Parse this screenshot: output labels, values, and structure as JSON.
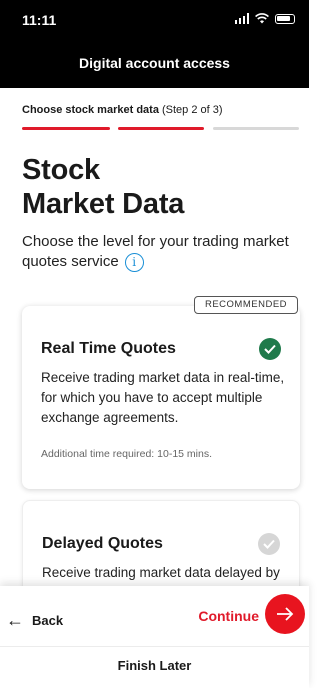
{
  "status_bar": {
    "time": "11:11"
  },
  "header": {
    "title": "Digital account access"
  },
  "step": {
    "label": "Choose stock market data",
    "counter": "(Step 2 of 3)"
  },
  "page": {
    "heading_line1": "Stock",
    "heading_line2": "Market Data",
    "subtitle": "Choose the level for your trading market quotes service"
  },
  "options": [
    {
      "badge": "RECOMMENDED",
      "title": "Real Time Quotes",
      "description": "Receive trading market data in real-time, for which you have to accept multiple exchange agreements.",
      "note": "Additional time required: 10-15 mins.",
      "selected": true
    },
    {
      "title": "Delayed Quotes",
      "description": "Receive trading market data delayed by",
      "selected": false
    }
  ],
  "footer": {
    "back_label": "Back",
    "continue_label": "Continue",
    "finish_label": "Finish Later"
  },
  "colors": {
    "accent": "#e01a2a",
    "selected_check": "#1f7a4b",
    "info": "#1a8fd6"
  }
}
